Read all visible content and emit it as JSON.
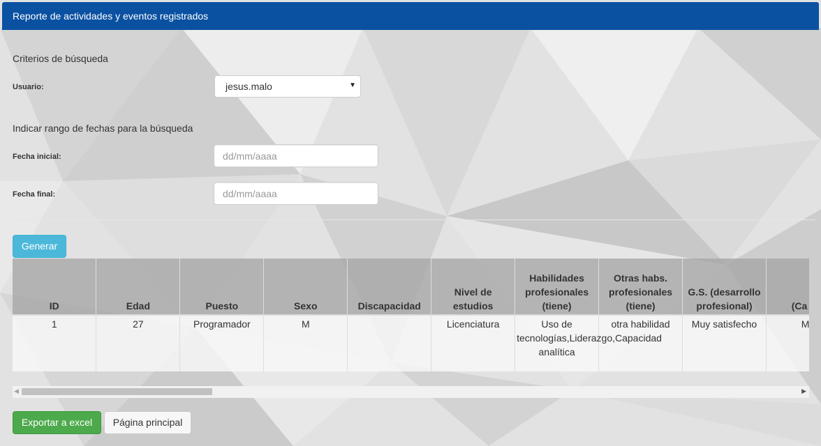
{
  "header": {
    "title": "Reporte de actividades y eventos registrados"
  },
  "search": {
    "criteria_title": "Criterios de búsqueda",
    "user_label": "Usuario:",
    "user_selected": "jesus.malo",
    "date_range_title": "Indicar rango de fechas para la búsqueda",
    "start_label": "Fecha inicial:",
    "start_placeholder": "dd/mm/aaaa",
    "end_label": "Fecha final:",
    "end_placeholder": "dd/mm/aaaa",
    "generate_button": "Generar"
  },
  "table": {
    "columns": [
      "ID",
      "Edad",
      "Puesto",
      "Sexo",
      "Discapacidad",
      "Nivel de estudios",
      "Habilidades profesionales (tiene)",
      "Otras habs. profesionales (tiene)",
      "G.S. (desarrollo profesional)",
      "(Ca p d"
    ],
    "rows": [
      [
        "1",
        "27",
        "Programador",
        "M",
        "",
        "Licenciatura",
        "Uso de tecnologías,Liderazgo,Capacidad analítica",
        "otra habilidad",
        "Muy satisfecho",
        "Mu"
      ]
    ]
  },
  "footer": {
    "export_button": "Exportar a excel",
    "home_button": "Página principal"
  },
  "colors": {
    "header": "#0a51a1",
    "info": "#4cb8d9",
    "success": "#4caa4c"
  }
}
